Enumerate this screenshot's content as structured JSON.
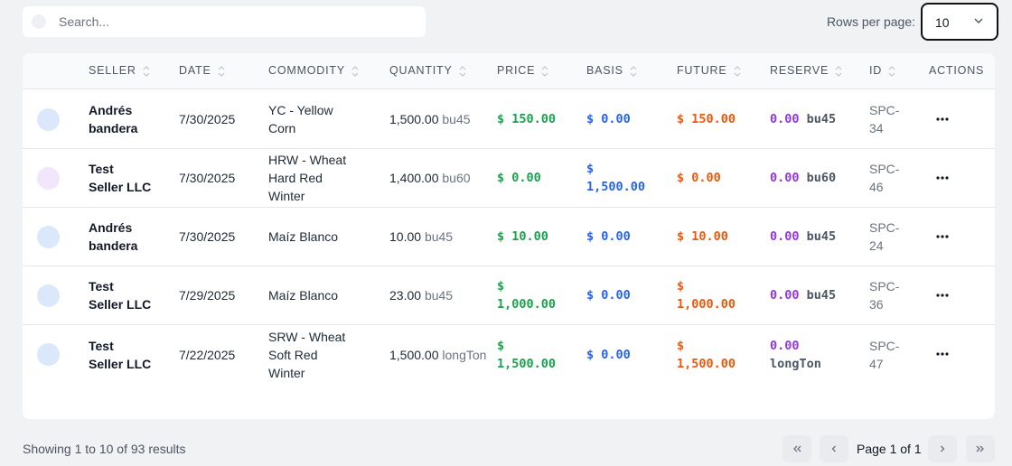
{
  "search": {
    "placeholder": "Search..."
  },
  "pagination_top": {
    "rows_label": "Rows per page:",
    "rows_value": "10"
  },
  "table": {
    "columns": [
      "SELLER",
      "DATE",
      "COMMODITY",
      "QUANTITY",
      "PRICE",
      "BASIS",
      "FUTURE",
      "RESERVE",
      "ID",
      "ACTIONS"
    ],
    "rows": [
      {
        "avatar_color": "#dbe8fb",
        "seller": [
          "Andrés",
          "bandera"
        ],
        "date": "7/30/2025",
        "commodity": [
          "YC - Yellow",
          "Corn"
        ],
        "qty_value": "1,500.00",
        "qty_unit": "bu45",
        "price": [
          "$ 150.00"
        ],
        "basis": [
          "$ 0.00"
        ],
        "future": [
          "$ 150.00"
        ],
        "reserve_value": "0.00",
        "reserve_unit": "bu45",
        "id": [
          "SPC-",
          "34"
        ]
      },
      {
        "avatar_color": "#f1e6fb",
        "seller": [
          "Test",
          "Seller LLC"
        ],
        "date": "7/30/2025",
        "commodity": [
          "HRW - Wheat",
          "Hard Red",
          "Winter"
        ],
        "qty_value": "1,400.00",
        "qty_unit": "bu60",
        "price": [
          "$ 0.00"
        ],
        "basis": [
          "$",
          "1,500.00"
        ],
        "future": [
          "$ 0.00"
        ],
        "reserve_value": "0.00",
        "reserve_unit": "bu60",
        "id": [
          "SPC-",
          "46"
        ]
      },
      {
        "avatar_color": "#dbe8fb",
        "seller": [
          "Andrés",
          "bandera"
        ],
        "date": "7/30/2025",
        "commodity": [
          "Maíz Blanco"
        ],
        "qty_value": "10.00",
        "qty_unit": "bu45",
        "price": [
          "$ 10.00"
        ],
        "basis": [
          "$ 0.00"
        ],
        "future": [
          "$ 10.00"
        ],
        "reserve_value": "0.00",
        "reserve_unit": "bu45",
        "id": [
          "SPC-",
          "24"
        ]
      },
      {
        "avatar_color": "#dbe8fb",
        "seller": [
          "Test",
          "Seller LLC"
        ],
        "date": "7/29/2025",
        "commodity": [
          "Maíz Blanco"
        ],
        "qty_value": "23.00",
        "qty_unit": "bu45",
        "price": [
          "$",
          "1,000.00"
        ],
        "basis": [
          "$ 0.00"
        ],
        "future": [
          "$",
          "1,000.00"
        ],
        "reserve_value": "0.00",
        "reserve_unit": "bu45",
        "id": [
          "SPC-",
          "36"
        ]
      },
      {
        "avatar_color": "#dbe8fb",
        "seller": [
          "Test",
          "Seller LLC"
        ],
        "date": "7/22/2025",
        "commodity": [
          "SRW - Wheat",
          "Soft Red",
          "Winter"
        ],
        "qty_value": "1,500.00",
        "qty_unit": "longTon",
        "price": [
          "$",
          "1,500.00"
        ],
        "basis": [
          "$ 0.00"
        ],
        "future": [
          "$",
          "1,500.00"
        ],
        "reserve_value": "0.00",
        "reserve_unit": "longTon",
        "id": [
          "SPC-",
          "47"
        ]
      }
    ]
  },
  "footer": {
    "results_text": "Showing 1 to 10 of 93 results",
    "page_text": "Page 1 of 1"
  },
  "icons": {
    "search": "search-icon",
    "chevron": "chevron-down-icon",
    "sort": "sort-icon",
    "more": "more-horizontal-icon",
    "first": "chevrons-left-icon",
    "prev": "chevron-left-icon",
    "next": "chevron-right-icon",
    "last": "chevrons-right-icon"
  },
  "colors": {
    "price": "#16a34a",
    "basis": "#2563eb",
    "future": "#ea580c",
    "reserve": "#9333ea"
  }
}
